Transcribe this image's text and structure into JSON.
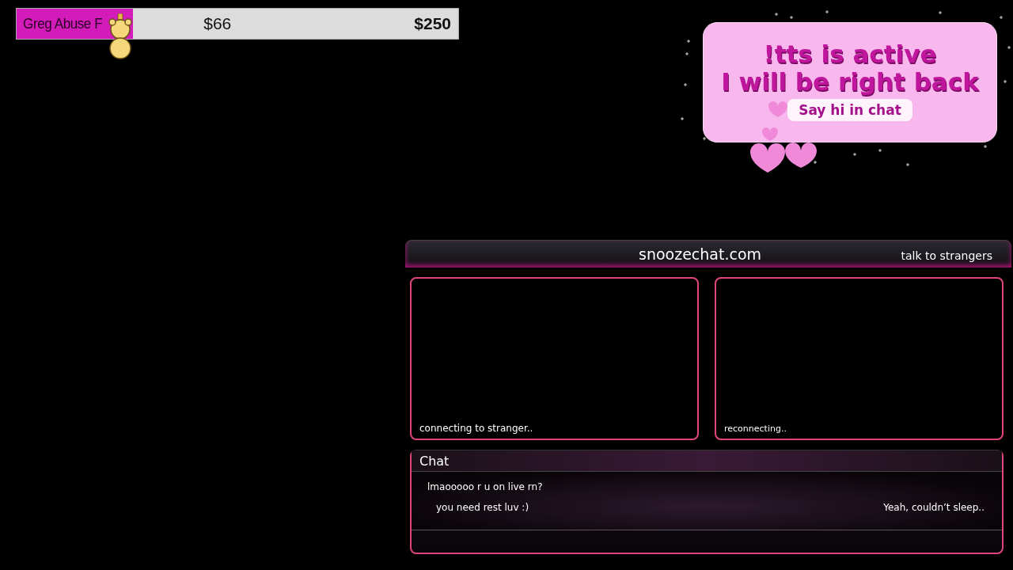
{
  "goal": {
    "label": "Greg Abuse F",
    "current": "$66",
    "target": "$250",
    "level": 0.264
  },
  "brb": {
    "lines": [
      "!tts is active",
      "I will be right back"
    ],
    "button": "Say hi in chat"
  },
  "chat_app": {
    "site": "snoozechat.com",
    "tagline": "talk to strangers",
    "videos": [
      {
        "status": "connecting to stranger.."
      },
      {
        "status": "reconnecting.."
      }
    ],
    "chat": {
      "title": "Chat",
      "messages": [
        {
          "kind": "received",
          "text": "lmaooooo r u on live rn?"
        },
        {
          "kind": "received",
          "text": "you need rest luv :)"
        },
        {
          "kind": "sent",
          "text": "Yeah, couldn’t sleep.."
        }
      ]
    }
  }
}
